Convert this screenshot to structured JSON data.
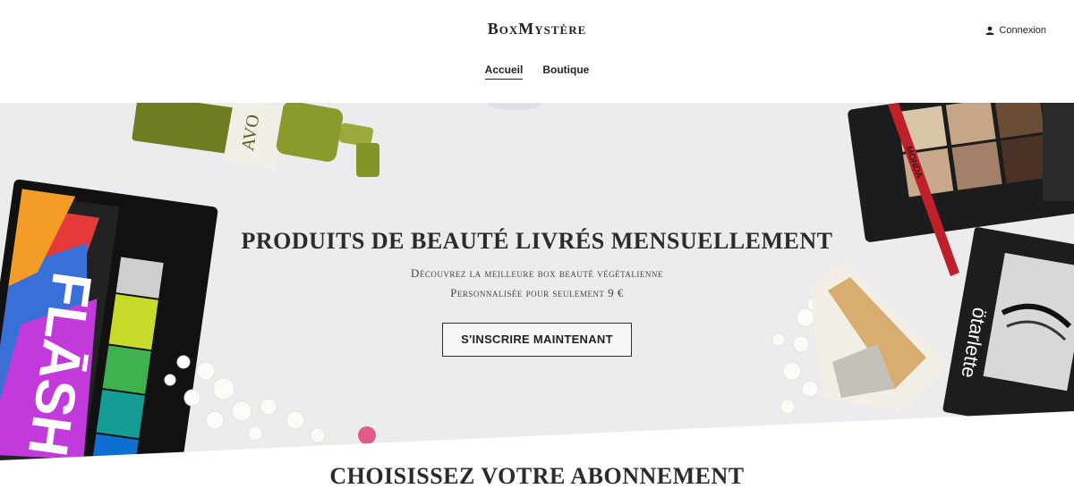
{
  "header": {
    "logo": "BoxMystère",
    "login_label": "Connexion",
    "nav": [
      {
        "label": "Accueil",
        "active": true
      },
      {
        "label": "Boutique",
        "active": false
      }
    ]
  },
  "hero": {
    "title": "PRODUITS DE BEAUTÉ LIVRÉS MENSUELLEMENT",
    "subtitle_line1": "Découvrez la meilleure box beauté végétalienne",
    "subtitle_line2": "Personnalisée pour seulement 9 €",
    "cta_label": "S'INSCRIRE MAINTENANT",
    "decor_text": {
      "palette_left": "FLĀSH",
      "lipliner": "MONDA",
      "lashes": "ötarlette",
      "bottle": "AVO"
    }
  },
  "section": {
    "title": "CHOISISSEZ VOTRE ABONNEMENT"
  },
  "colors": {
    "background": "#ffffff",
    "hero_bg": "#ecebee",
    "text": "#222222",
    "bottle_green": "#7d8a2a"
  }
}
